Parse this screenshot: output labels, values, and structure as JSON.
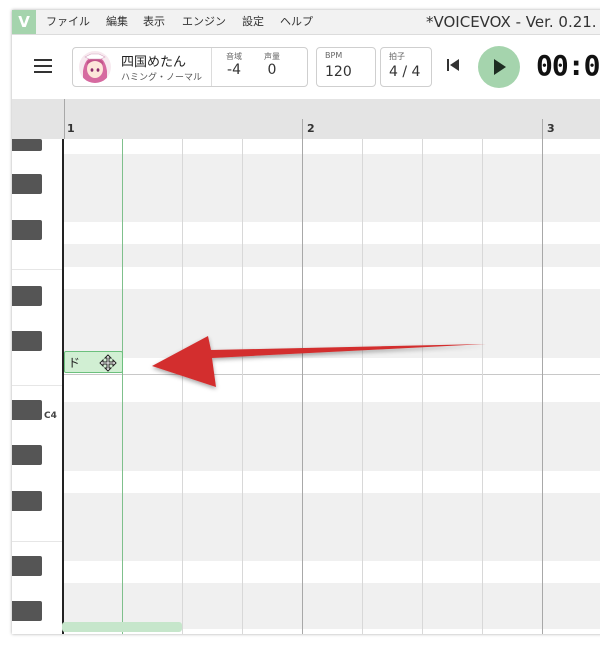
{
  "app": {
    "logo": "V",
    "window_title": "*VOICEVOX - Ver. 0.21.",
    "menu": [
      "ファイル",
      "編集",
      "表示",
      "エンジン",
      "設定",
      "ヘルプ"
    ]
  },
  "toolbar": {
    "singer_name": "四国めたん",
    "singer_style": "ハミング・ノーマル",
    "pitch_label": "音域",
    "pitch_value": "-4",
    "volume_label": "声量",
    "volume_value": "0",
    "bpm_label": "BPM",
    "bpm_value": "120",
    "beat_label": "拍子",
    "beat_value": "4 / 4",
    "time": "00:0"
  },
  "editor": {
    "measures": [
      "1",
      "2",
      "3"
    ],
    "c4_label": "C4",
    "note_lyric": "ド"
  },
  "colors": {
    "accent": "#a5d4ad",
    "note_fill": "#d1efd3",
    "note_border": "#6cc07d",
    "arrow": "#d32f2f"
  }
}
